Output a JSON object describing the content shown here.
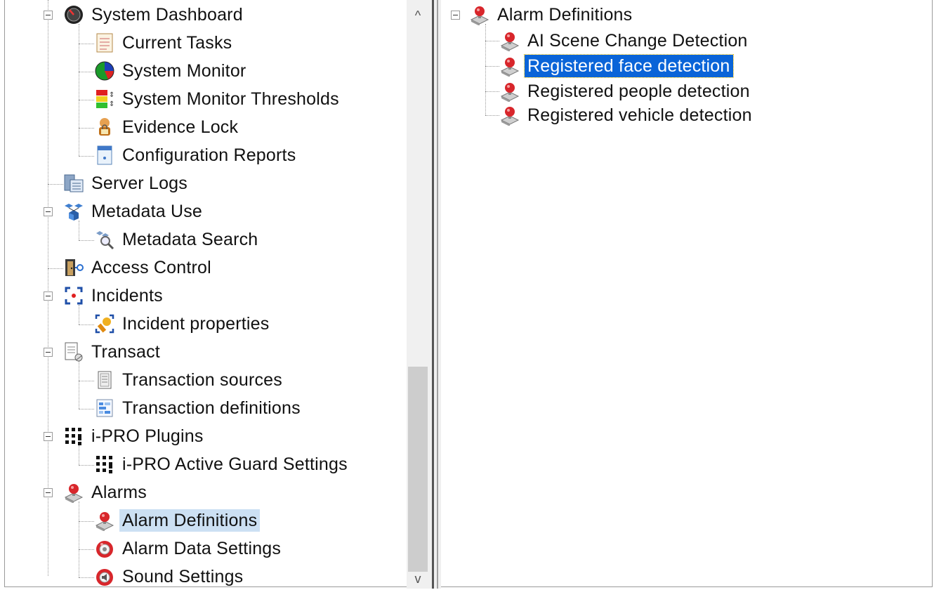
{
  "left_tree": {
    "nodes": [
      {
        "id": "system-dashboard",
        "label": "System Dashboard",
        "icon": "gauge-icon"
      },
      {
        "id": "current-tasks",
        "label": "Current Tasks",
        "icon": "task-list-icon"
      },
      {
        "id": "system-monitor",
        "label": "System Monitor",
        "icon": "pie-monitor-icon"
      },
      {
        "id": "system-monitor-thresholds",
        "label": "System Monitor Thresholds",
        "icon": "thresholds-icon"
      },
      {
        "id": "evidence-lock",
        "label": "Evidence Lock",
        "icon": "evidence-lock-icon"
      },
      {
        "id": "configuration-reports",
        "label": "Configuration Reports",
        "icon": "report-icon"
      },
      {
        "id": "server-logs",
        "label": "Server Logs",
        "icon": "server-logs-icon"
      },
      {
        "id": "metadata-use",
        "label": "Metadata Use",
        "icon": "metadata-icon"
      },
      {
        "id": "metadata-search",
        "label": "Metadata Search",
        "icon": "metadata-search-icon"
      },
      {
        "id": "access-control",
        "label": "Access Control",
        "icon": "door-icon"
      },
      {
        "id": "incidents",
        "label": "Incidents",
        "icon": "incident-icon"
      },
      {
        "id": "incident-properties",
        "label": "Incident properties",
        "icon": "incident-properties-icon"
      },
      {
        "id": "transact",
        "label": "Transact",
        "icon": "transact-icon"
      },
      {
        "id": "transaction-sources",
        "label": "Transaction sources",
        "icon": "transaction-sources-icon"
      },
      {
        "id": "transaction-definitions",
        "label": "Transaction definitions",
        "icon": "transaction-definitions-icon"
      },
      {
        "id": "ipro-plugins",
        "label": "i-PRO Plugins",
        "icon": "plugin-dots-icon"
      },
      {
        "id": "ipro-active-guard-settings",
        "label": "i-PRO Active Guard Settings",
        "icon": "plugin-dots-icon"
      },
      {
        "id": "alarms",
        "label": "Alarms",
        "icon": "alarm-icon"
      },
      {
        "id": "alarm-definitions",
        "label": "Alarm Definitions",
        "icon": "alarm-icon",
        "selected": true
      },
      {
        "id": "alarm-data-settings",
        "label": "Alarm Data Settings",
        "icon": "alarm-settings-icon"
      },
      {
        "id": "sound-settings",
        "label": "Sound Settings",
        "icon": "sound-icon"
      }
    ]
  },
  "right_tree": {
    "root": {
      "label": "Alarm Definitions",
      "icon": "alarm-icon"
    },
    "children": [
      {
        "label": "AI Scene Change Detection",
        "icon": "alarm-icon"
      },
      {
        "label": "Registered face detection",
        "icon": "alarm-icon",
        "selected": true
      },
      {
        "label": "Registered people detection",
        "icon": "alarm-icon"
      },
      {
        "label": "Registered vehicle detection",
        "icon": "alarm-icon"
      }
    ]
  },
  "scrollbar": {
    "up_arrow": "^",
    "down_arrow": "v"
  },
  "colors": {
    "selection_active": "#0a64d8",
    "selection_inactive": "#cce0f3",
    "alarm_red": "#d8262b"
  }
}
